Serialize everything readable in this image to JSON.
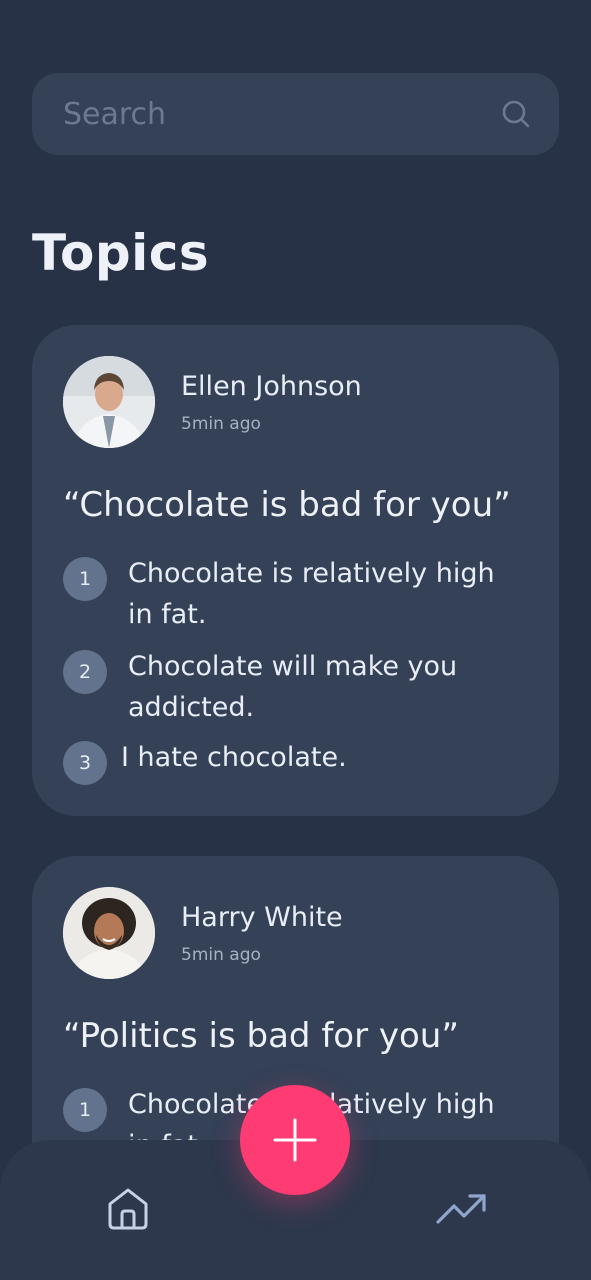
{
  "search": {
    "placeholder": "Search"
  },
  "page": {
    "title": "Topics"
  },
  "topics": [
    {
      "author": "Ellen Johnson",
      "time": "5min ago",
      "quote": "“Chocolate is bad for you”",
      "points": [
        {
          "number": "1",
          "text": "Chocolate is relatively high in fat."
        },
        {
          "number": "2",
          "text": "Chocolate will make you addicted."
        },
        {
          "number": "3",
          "text": "I hate chocolate."
        }
      ]
    },
    {
      "author": "Harry White",
      "time": "5min ago",
      "quote": "“Politics is bad for you”",
      "points": [
        {
          "number": "1",
          "text": "Chocolate is relatively high in fat."
        }
      ]
    }
  ],
  "nav": {
    "home_icon": "home-icon",
    "trending_icon": "trending-up-icon",
    "add_icon": "plus-icon"
  },
  "colors": {
    "background": "#273246",
    "card": "#344157",
    "accent": "#ff3b73",
    "badge": "#63728d"
  }
}
